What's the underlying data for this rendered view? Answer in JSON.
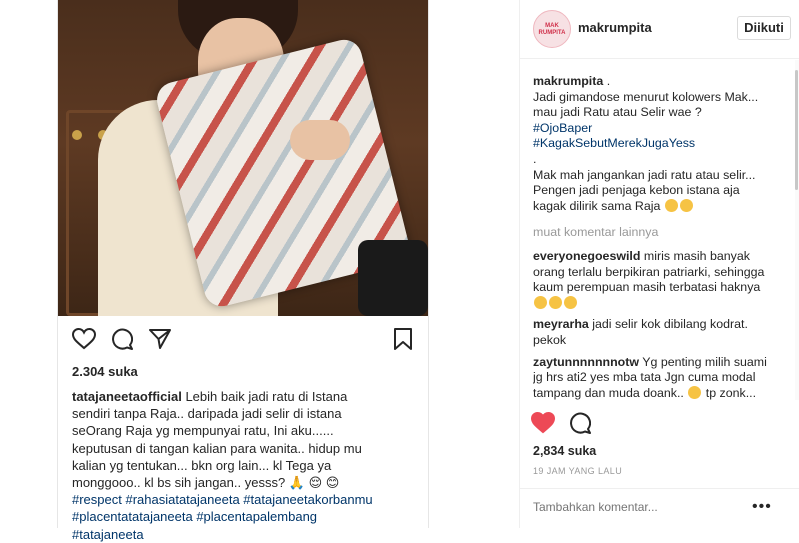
{
  "colors": {
    "heart_red": "#ed4956",
    "link_blue": "#003569",
    "muted": "#999999"
  },
  "left_post": {
    "likes": "2.304 suka",
    "caption": {
      "username": "tatajaneetaofficial",
      "lines": [
        "Lebih baik jadi ratu di Istana",
        "sendiri tanpa Raja.. daripada jadi selir di istana",
        "seOrang Raja yg mempunyai ratu, Ini aku......",
        "keputusan di tangan kalian para wanita.. hidup mu",
        "kalian yg tentukan... bkn org lain... kl Tega ya",
        "monggooo.. kl bs sih jangan.. yesss? 🙏 😌 😊",
        "#respect #rahasiatatajaneeta #tatajaneetakorbanmu",
        "#placentatatajaneeta #placentapalembang",
        "#tatajaneeta"
      ]
    },
    "icons": [
      "heart-outline-icon",
      "comment-icon",
      "share-icon",
      "bookmark-icon"
    ]
  },
  "right_post": {
    "username": "makrumpita",
    "avatar_text": "MAK RUMPITA",
    "follow_label": "Diikuti",
    "caption": {
      "username": "makrumpita",
      "lines": [
        " .",
        "Jadi gimandose menurut kolowers Mak...",
        "mau jadi Ratu atau Selir wae ?",
        "#OjoBaper",
        "#KagakSebutMerekJugaYess",
        ".",
        "Mak mah jangankan jadi ratu atau selir...",
        "Pengen jadi penjaga kebon istana aja",
        "kagak dilirik sama Raja"
      ]
    },
    "load_more": "muat komentar lainnya",
    "comments": [
      {
        "user": "everyonegoeswild",
        "lines": [
          " miris masih banyak",
          "orang terlalu berpikiran patriarki, sehingga",
          "kaum perempuan masih terbatasi haknya"
        ]
      },
      {
        "user": "meyrarha",
        "lines": [
          " jadi selir kok dibilang kodrat.",
          "pekok"
        ]
      },
      {
        "user": "zaytunnnnnnnotw",
        "lines": [
          " Yg penting milih suami",
          "jg hrs ati2 yes mba tata Jgn cuma modal",
          "tampang dan muda doank..",
          " tp zonk..."
        ]
      }
    ],
    "likes": "2,834 suka",
    "timestamp": "19 JAM YANG LALU",
    "comment_placeholder": "Tambahkan komentar...",
    "more_label": "•••"
  }
}
